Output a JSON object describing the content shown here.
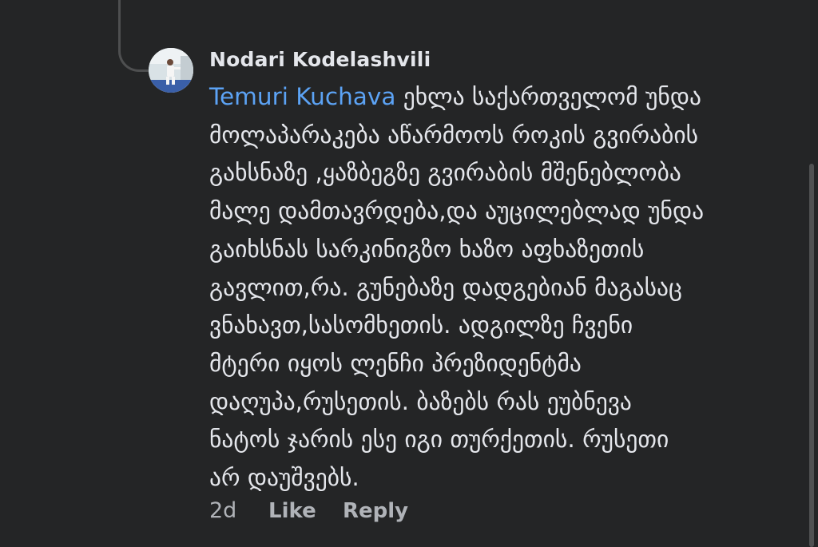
{
  "comment": {
    "author": "Nodari Kodelashvili",
    "mention": "Temuri Kuchava",
    "lines": [
      " ეხლა საქართველომ უნდა",
      "მოლაპარაკება აწარმოოს როკის გვირაბის",
      "გახსნაზე ,ყაზბეგზე გვირაბის მშენებლობა",
      "მალე დამთავრდება,და აუცილებლად უნდა",
      "გაიხსნას სარკინიგზო  ხაზო აფხაზეთის",
      "გავლით,რა.  გუნებაზე დადგებიან  მაგასაც",
      "ვნახავთ,სასომხეთის. ადგილზე ჩვენი",
      "მტერი იყოს  ლენჩი პრეზიდენტმა",
      "დაღუპა,რუსეთის.  ბაზებს რას ეუბნევა",
      "ნატოს ჯარის ესე იგი თურქეთის. რუსეთი",
      "არ დაუშვებს."
    ],
    "time": "2d",
    "like_label": "Like",
    "reply_label": "Reply"
  },
  "colors": {
    "background": "#242526",
    "text": "#e4e6eb",
    "mention": "#5ca3f5",
    "secondary": "#b0b3b8"
  }
}
